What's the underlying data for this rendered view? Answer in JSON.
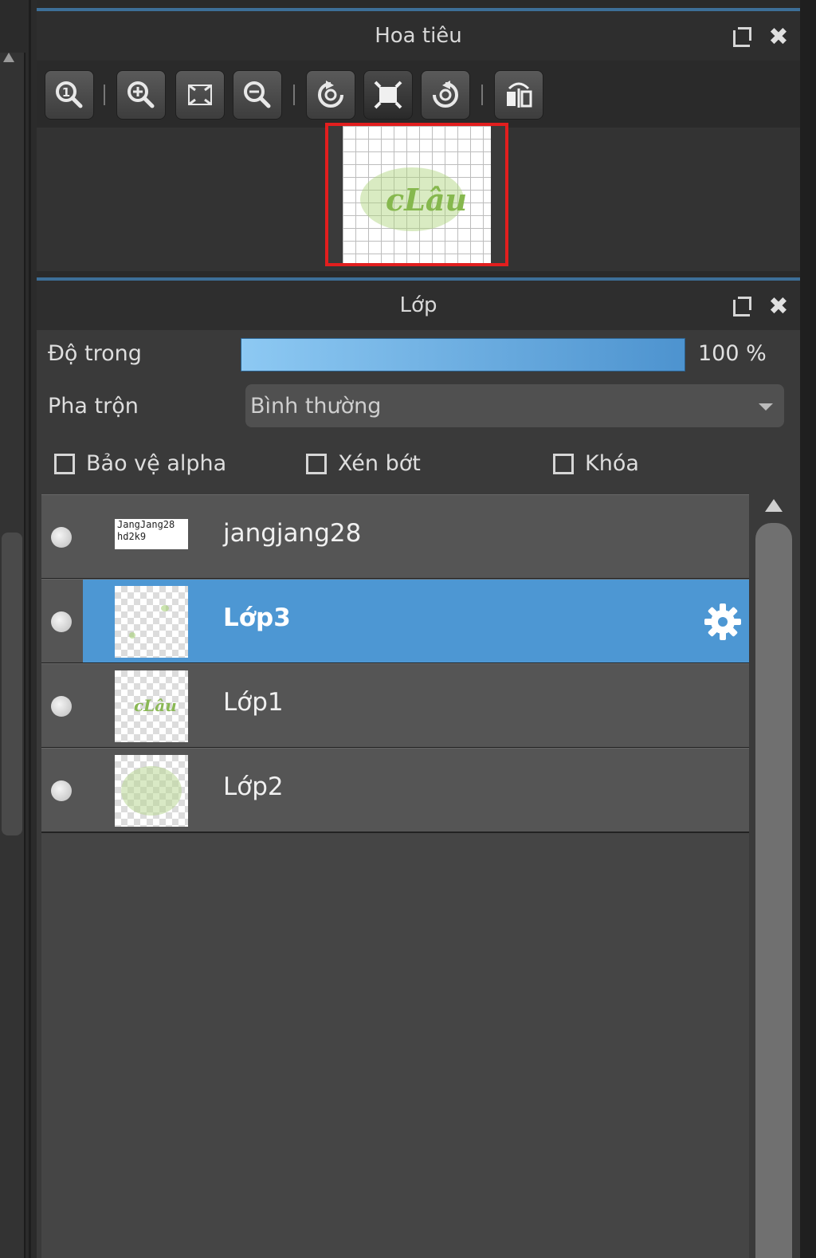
{
  "navigator": {
    "title": "Hoa tiêu",
    "toolbar": [
      {
        "icon": "zoom-actual-icon"
      },
      {
        "icon": "zoom-in-icon"
      },
      {
        "icon": "fit-screen-icon"
      },
      {
        "icon": "zoom-out-icon"
      },
      {
        "icon": "rotate-left-icon"
      },
      {
        "icon": "reset-view-icon"
      },
      {
        "icon": "rotate-right-icon"
      },
      {
        "icon": "flip-horizontal-icon"
      }
    ],
    "preview_text": "cLâu",
    "frame_color": "#e21e1e"
  },
  "layers": {
    "title": "Lớp",
    "opacity_label": "Độ trong",
    "opacity_value": "100 %",
    "blend_label": "Pha trộn",
    "blend_value": "Bình thường",
    "options": {
      "protect_alpha": "Bảo vệ alpha",
      "clipping": "Xén bớt",
      "lock": "Khóa"
    },
    "list": [
      {
        "name": "jangjang28",
        "thumb_text": "JangJang28\nhd2k9",
        "selected": false
      },
      {
        "name": "Lớp3",
        "selected": true
      },
      {
        "name": "Lớp1",
        "thumb_text": "cLâu",
        "selected": false
      },
      {
        "name": "Lớp2",
        "selected": false
      }
    ],
    "accent_color": "#4d97d3"
  }
}
